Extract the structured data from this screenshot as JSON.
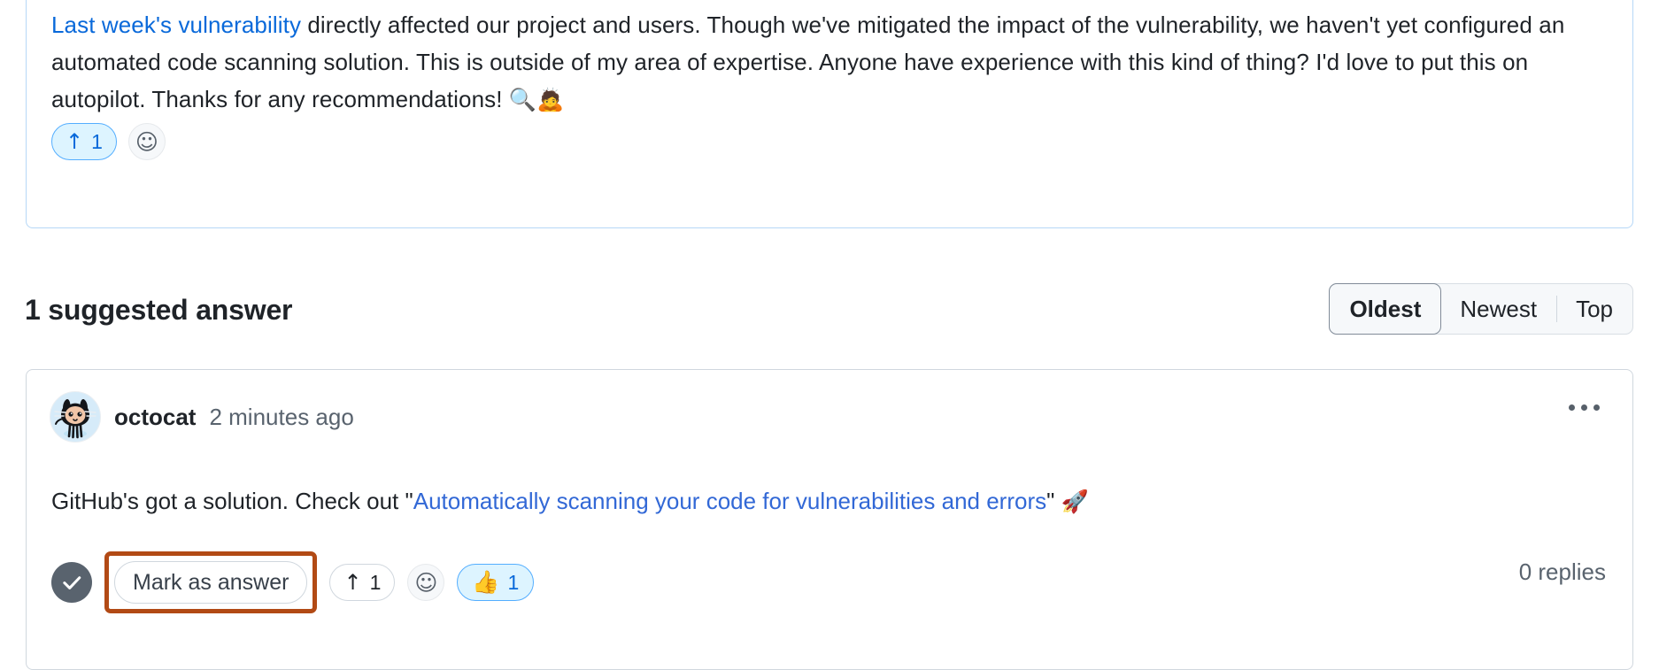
{
  "question": {
    "link_text": "Last week's vulnerability",
    "text_part1": " directly affected our project and users. Though we've mitigated the impact of the vulnerability, we haven't yet configured an automated code scanning solution. This is outside of my area of expertise. Anyone have experience with this kind of thing? I'd love to put this on autopilot. Thanks for any recommendations! ",
    "emoji": "🔍🙇",
    "upvote_icon": "↑",
    "upvote_count": "1",
    "reaction_icon": "☺",
    "link_color": "#0969da"
  },
  "section": {
    "title": "1 suggested answer",
    "sort": {
      "options": [
        "Oldest",
        "Newest",
        "Top"
      ],
      "selected": "Oldest"
    }
  },
  "answer": {
    "author": "octocat",
    "timestamp": "2 minutes ago",
    "avatar_name": "octocat-avatar",
    "menu_icon": "kebab-horizontal-icon",
    "body_prefix": "GitHub's got a solution. Check out \"",
    "body_link": "Automatically scanning your code for vulnerabilities and errors",
    "body_suffix": "\" ",
    "body_emoji": "🚀",
    "link_color": "#3268d6",
    "actions": {
      "answer_check_icon": "check-circle-icon",
      "mark_as_answer_label": "Mark as answer",
      "highlight_color": "#b24a15",
      "upvote_icon": "↑",
      "upvote_count": "1",
      "reaction_icon": "☺",
      "thumbs_emoji": "👍",
      "thumbs_count": "1",
      "replies_label": "0 replies"
    }
  }
}
